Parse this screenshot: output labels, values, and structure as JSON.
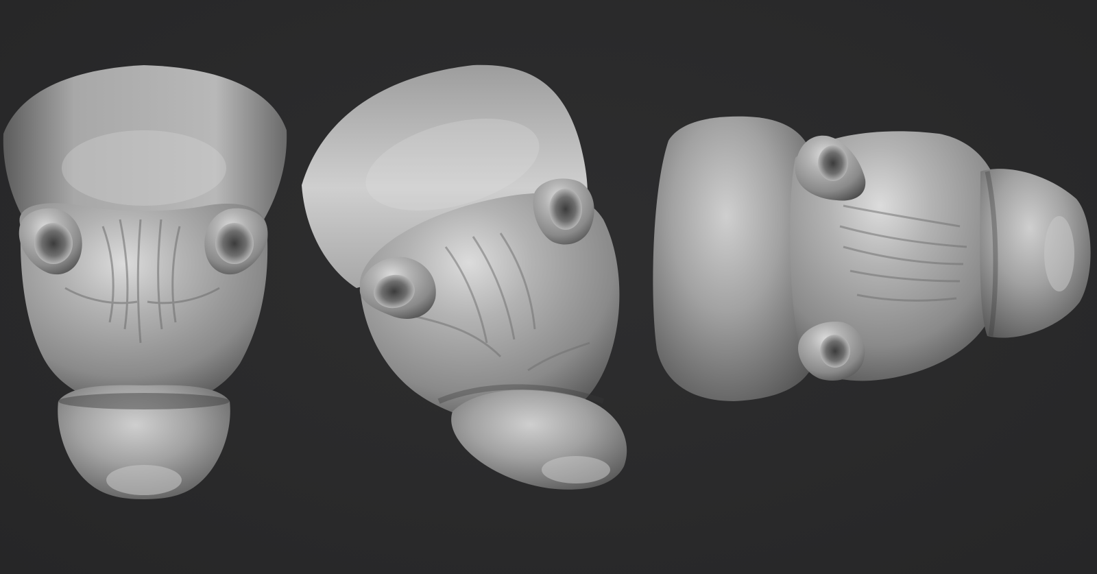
{
  "viewport": {
    "background_color": "#2a2a2b",
    "material_color": "#9a9a9a",
    "shading": "matcap-gray"
  },
  "models": [
    {
      "view": "front",
      "icon": "hippo-head-sculpt"
    },
    {
      "view": "three-quarter",
      "icon": "hippo-head-sculpt"
    },
    {
      "view": "top",
      "icon": "hippo-head-sculpt"
    }
  ]
}
